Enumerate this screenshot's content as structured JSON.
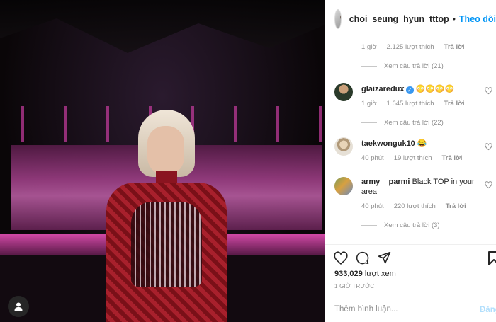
{
  "header": {
    "username": "choi_seung_hyun_tttop",
    "separator": "•",
    "follow_label": "Theo dõi"
  },
  "comments": [
    {
      "meta": {
        "time": "1 giờ",
        "likes": "2.125 lượt thích",
        "reply": "Trả lời"
      },
      "view_replies": "Xem câu trả lời (21)"
    },
    {
      "username": "glaizaredux",
      "verified": true,
      "text": "😳😳😳😳",
      "meta": {
        "time": "1 giờ",
        "likes": "1.645 lượt thích",
        "reply": "Trả lời"
      },
      "view_replies": "Xem câu trả lời (22)"
    },
    {
      "username": "taekwonguk10",
      "text": "😂",
      "meta": {
        "time": "40 phút",
        "likes": "19 lượt thích",
        "reply": "Trả lời"
      }
    },
    {
      "username": "army__parmi",
      "text": "Black TOP in your area",
      "meta": {
        "time": "40 phút",
        "likes": "220 lượt thích",
        "reply": "Trả lời"
      },
      "view_replies": "Xem câu trả lời (3)"
    }
  ],
  "stats": {
    "views_count": "933,029",
    "views_label": "lượt xem",
    "posted": "1 GIỜ TRƯỚC"
  },
  "add_comment": {
    "placeholder": "Thêm bình luận...",
    "post_label": "Đăng"
  },
  "colors": {
    "link_blue": "#0095f6",
    "muted": "#8e8e8e",
    "text": "#262626",
    "verified": "#3897f0"
  }
}
